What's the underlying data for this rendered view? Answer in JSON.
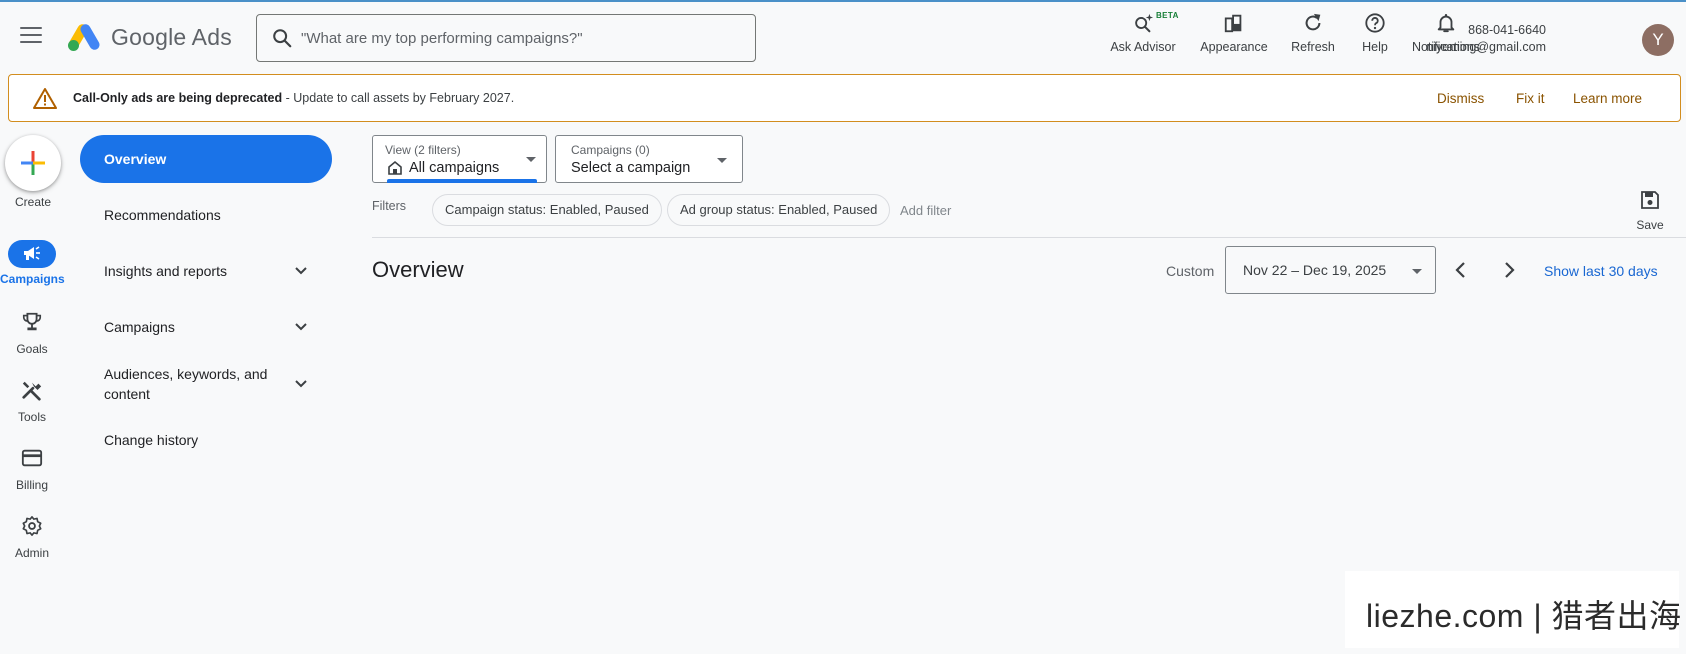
{
  "header": {
    "app_name": "Google Ads",
    "search_placeholder": "\"What are my top performing campaigns?\"",
    "buttons": {
      "ask_advisor": "Ask Advisor",
      "beta": "BETA",
      "appearance": "Appearance",
      "refresh": "Refresh",
      "help": "Help",
      "notifications": "Notifications"
    },
    "account": {
      "id": "868-041-6640",
      "email": "niyeming@gmail.com",
      "avatar_initial": "Y"
    }
  },
  "banner": {
    "title": "Call-Only ads are being deprecated",
    "message": " - Update to call assets by February 2027.",
    "dismiss": "Dismiss",
    "fix_it": "Fix it",
    "learn_more": "Learn more"
  },
  "rail": {
    "create": "Create",
    "campaigns": "Campaigns",
    "goals": "Goals",
    "tools": "Tools",
    "billing": "Billing",
    "admin": "Admin"
  },
  "nav": {
    "overview": "Overview",
    "recommendations": "Recommendations",
    "insights": "Insights and reports",
    "campaigns": "Campaigns",
    "audiences": "Audiences, keywords, and content",
    "change_history": "Change history"
  },
  "main": {
    "view_label": "View (2 filters)",
    "view_value": "All campaigns",
    "campaigns_label": "Campaigns (0)",
    "campaigns_value": "Select a campaign",
    "filters_label": "Filters",
    "chip_campaign_status": "Campaign status: Enabled, Paused",
    "chip_adgroup_status": "Ad group status: Enabled, Paused",
    "add_filter": "Add filter",
    "save": "Save",
    "title": "Overview",
    "date_mode": "Custom",
    "date_range": "Nov 22 – Dec 19, 2025",
    "show_last": "Show last 30 days"
  },
  "watermark": "liezhe.com | 猎者出海",
  "colors": {
    "accent": "#1a73e8",
    "banner_border": "#d28d1e",
    "banner_action": "#8a5300",
    "link": "#1967d2",
    "avatar": "#8d6e63"
  }
}
